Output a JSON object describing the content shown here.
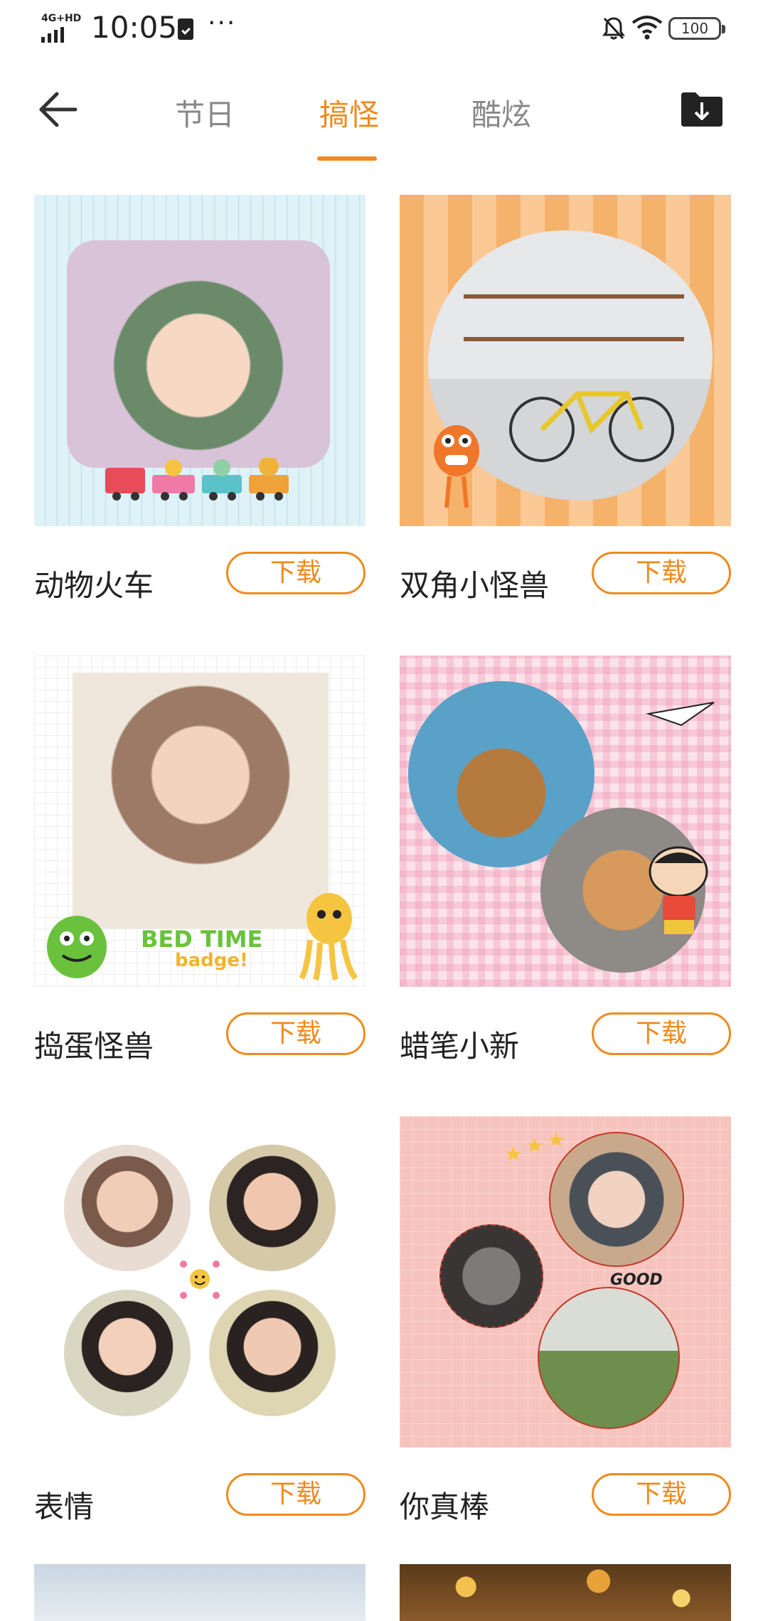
{
  "status_bar": {
    "network": "4G+HD",
    "time": "10:05",
    "more": "···",
    "battery": "100"
  },
  "header": {
    "tabs": [
      {
        "label": "节日",
        "active": false
      },
      {
        "label": "搞怪",
        "active": true
      },
      {
        "label": "酷炫",
        "active": false
      }
    ],
    "accent_color": "#f08a1c",
    "icons": [
      "back-arrow-icon",
      "download-folder-icon"
    ]
  },
  "templates": [
    {
      "title": "动物火车",
      "button": "下载"
    },
    {
      "title": "双角小怪兽",
      "button": "下载"
    },
    {
      "title": "捣蛋怪兽",
      "button": "下载",
      "art_text": "BED TIME",
      "art_sub": "badge!"
    },
    {
      "title": "蜡笔小新",
      "button": "下载"
    },
    {
      "title": "表情",
      "button": "下载"
    },
    {
      "title": "你真棒",
      "button": "下载",
      "art_text": "GOOD"
    }
  ]
}
